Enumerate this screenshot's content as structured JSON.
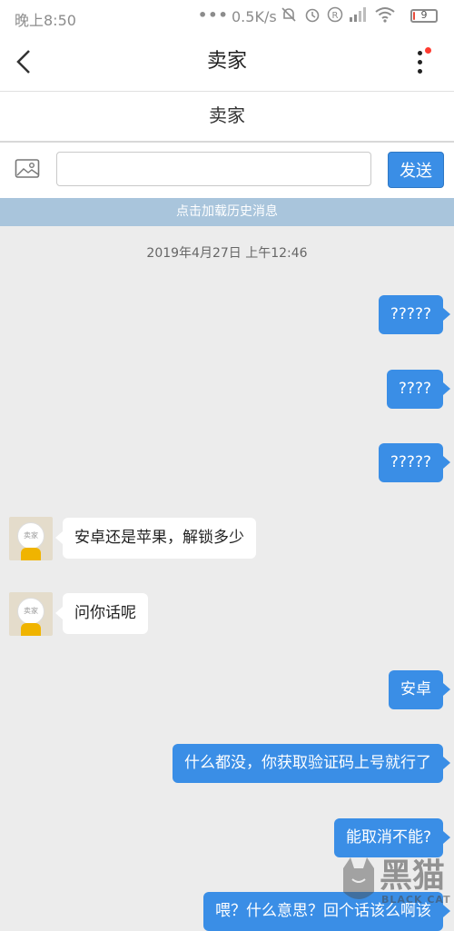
{
  "status_bar": {
    "time": "晚上8:50",
    "dots": "•••",
    "network_speed": "0.5K/s",
    "icons": [
      "mute-icon",
      "alarm-icon",
      "registered-icon",
      "signal-icon",
      "wifi-icon"
    ],
    "battery": "9",
    "battery_level": 0.09
  },
  "header": {
    "title": "卖家",
    "back_icon": "chevron-left-icon",
    "more_icon": "more-vertical-icon",
    "notification_color": "#ff3b30"
  },
  "sub_header": {
    "title": "卖家"
  },
  "input_bar": {
    "image_icon": "image-icon",
    "input_value": "",
    "input_placeholder": "",
    "send_label": "发送"
  },
  "history_bar": {
    "label": "点击加载历史消息"
  },
  "timestamp": "2019年4月27日 上午12:46",
  "messages": [
    {
      "side": "out",
      "text": "?????"
    },
    {
      "side": "out",
      "text": "????"
    },
    {
      "side": "out",
      "text": "?????"
    },
    {
      "side": "in",
      "text": "安卓还是苹果，解锁多少",
      "avatar_label": "卖家"
    },
    {
      "side": "in",
      "text": "问你话呢",
      "avatar_label": "卖家"
    },
    {
      "side": "out",
      "text": "安卓"
    },
    {
      "side": "out",
      "text": "什么都没，你获取验证码上号就行了"
    },
    {
      "side": "out",
      "text": "能取消不能?"
    },
    {
      "side": "out",
      "text": "喂？什么意思？回个话该么啊该"
    }
  ],
  "watermark": {
    "text": "黑猫",
    "sub": "BLACK CAT"
  },
  "colors": {
    "accent": "#3a8ee6",
    "history_bar": "#a9c5dc",
    "background": "#ececec"
  }
}
